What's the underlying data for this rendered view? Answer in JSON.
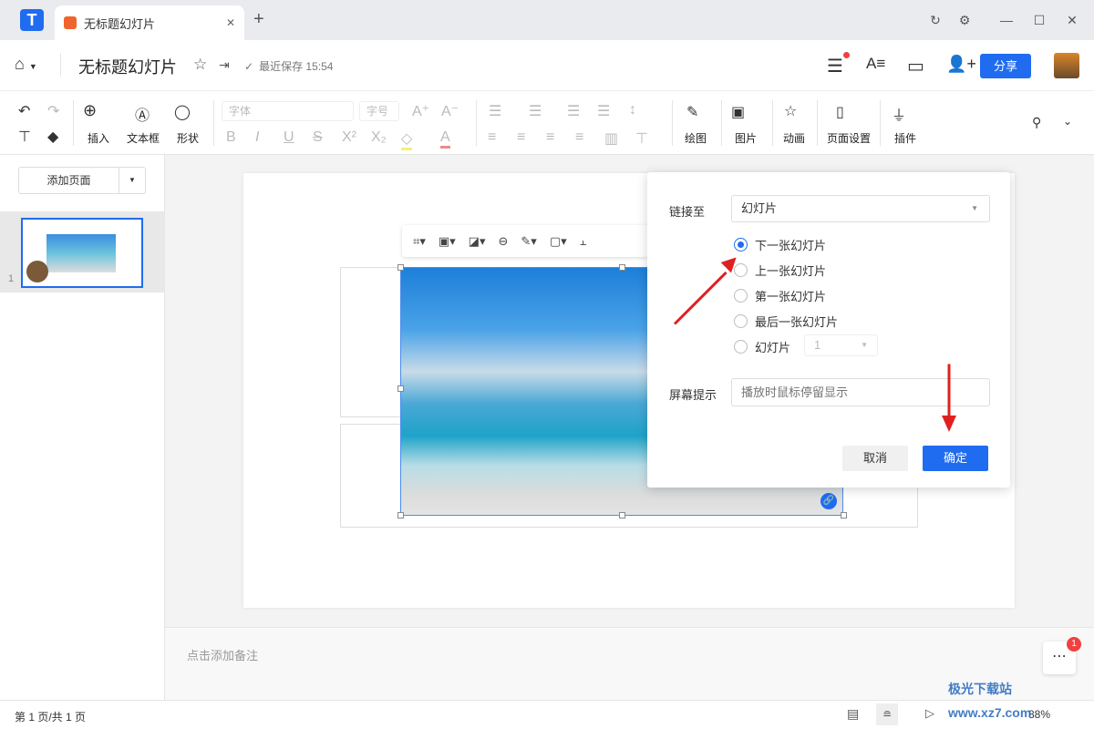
{
  "app": {
    "tab_title": "无标题幻灯片",
    "new_tab": "+",
    "window_controls": [
      "↻",
      "⚙",
      "—",
      "☐",
      "✕"
    ]
  },
  "header": {
    "title": "无标题幻灯片",
    "save_status": "最近保存 15:54",
    "share": "分享",
    "home_icon": "home-icon"
  },
  "toolbar": {
    "insert": "插入",
    "textbox": "文本框",
    "shape": "形状",
    "font_placeholder": "字体",
    "size_placeholder": "字号",
    "draw": "绘图",
    "picture": "图片",
    "animation": "动画",
    "page_setup": "页面设置",
    "plugin": "插件"
  },
  "left": {
    "add_page": "添加页面",
    "slide_number": "1"
  },
  "notes": {
    "placeholder": "点击添加备注"
  },
  "status": {
    "page": "第 1 页/共 1 页",
    "zoom": "88%"
  },
  "dialog": {
    "link_to_label": "链接至",
    "link_to_value": "幻灯片",
    "options": [
      {
        "label": "下一张幻灯片",
        "selected": true
      },
      {
        "label": "上一张幻灯片",
        "selected": false
      },
      {
        "label": "第一张幻灯片",
        "selected": false
      },
      {
        "label": "最后一张幻灯片",
        "selected": false
      },
      {
        "label": "幻灯片",
        "selected": false
      }
    ],
    "slide_select": "1",
    "tip_label": "屏幕提示",
    "tip_placeholder": "播放时鼠标停留显示",
    "cancel": "取消",
    "ok": "确定"
  },
  "notification_count": "1",
  "watermark": "极光下载站 www.xz7.com",
  "colors": {
    "accent": "#1f6cf0",
    "arrow": "#e02020"
  }
}
